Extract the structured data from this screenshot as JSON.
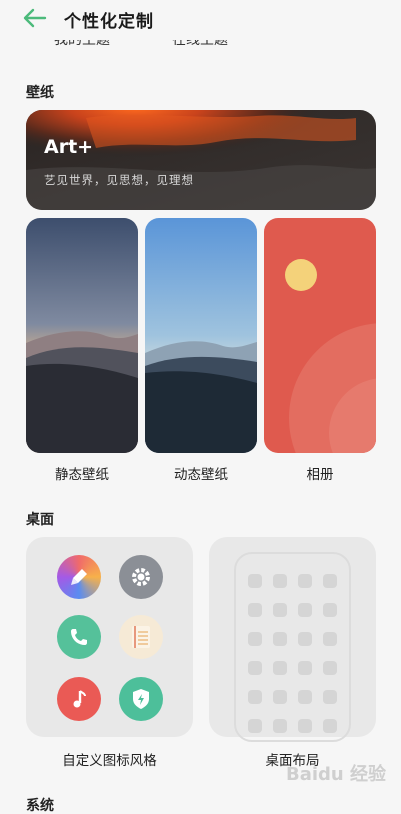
{
  "header": {
    "title": "个性化定制",
    "back_icon": "arrow-left-icon",
    "accent": "#4cba7b"
  },
  "top_row": {
    "left_label": "我的主题",
    "right_label": "在线主题"
  },
  "wallpaper_section": {
    "title": "壁纸",
    "banner": {
      "title": "Art+",
      "subtitle": "艺见世界，见思想，见理想"
    },
    "cards": [
      {
        "label": "静态壁纸"
      },
      {
        "label": "动态壁纸"
      },
      {
        "label": "相册"
      }
    ]
  },
  "desktop_section": {
    "title": "桌面",
    "icon_style": {
      "label": "自定义图标风格",
      "icons": [
        "brush-icon",
        "gear-icon",
        "phone-icon",
        "notes-icon",
        "music-note-icon",
        "shield-icon"
      ]
    },
    "layout": {
      "label": "桌面布局"
    }
  },
  "system_section": {
    "title": "系统"
  },
  "watermark": "Baidu 经验"
}
